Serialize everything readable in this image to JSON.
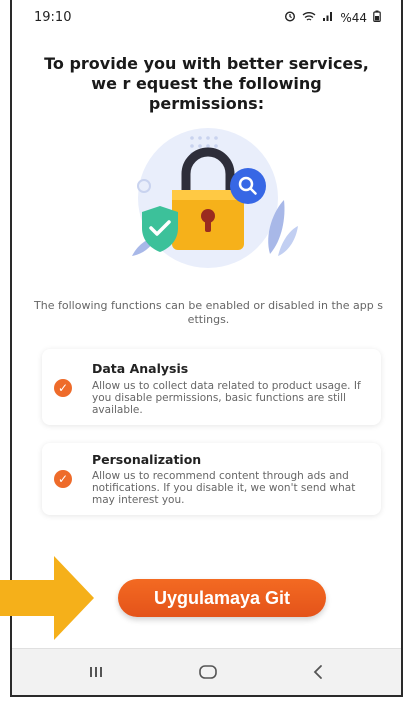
{
  "status_bar": {
    "time": "19:10",
    "battery": "%44"
  },
  "header": {
    "title": "To provide you with better services, we r equest the following permissions:"
  },
  "description": "The following functions can be enabled or disabled in the app s ettings.",
  "permissions": [
    {
      "title": "Data Analysis",
      "text": "Allow us to collect data related to product usage. If you disable permissions, basic functions are still available.",
      "checked": true
    },
    {
      "title": "Personalization",
      "text": "Allow us to recommend content through ads and notifications. If you disable it, we won't send what may interest you.",
      "checked": true
    }
  ],
  "cta": {
    "label": "Uygulamaya Git"
  },
  "nav_bar": {
    "items": [
      "recents-icon",
      "home-icon",
      "back-icon"
    ]
  },
  "colors": {
    "accent": "#ee6b2a",
    "button": "#e4531a",
    "arrow": "#f5b01a",
    "lock": "#f6b11a",
    "shield": "#3cc19a",
    "search_badge": "#3767e5"
  }
}
